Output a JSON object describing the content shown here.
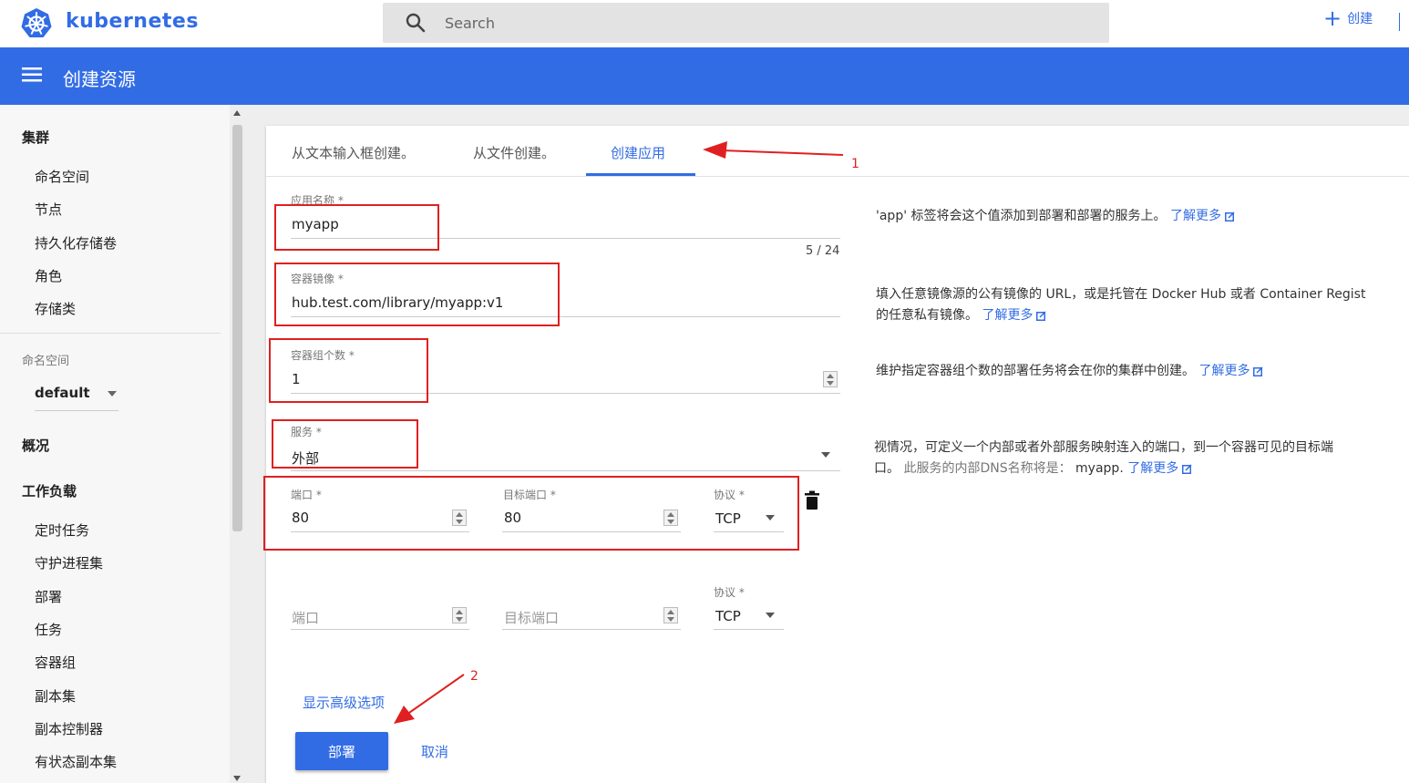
{
  "app": {
    "name": "kubernetes"
  },
  "search": {
    "placeholder": "Search"
  },
  "topbar": {
    "create_label": "创建",
    "create_icon": "plus-icon"
  },
  "header": {
    "title": "创建资源",
    "menu_icon": "hamburger-menu-icon"
  },
  "sidebar": {
    "cluster": {
      "title": "集群",
      "items": [
        "命名空间",
        "节点",
        "持久化存储卷",
        "角色",
        "存储类"
      ]
    },
    "namespace": {
      "label": "命名空间",
      "value": "default"
    },
    "overview": "概况",
    "workloads": {
      "title": "工作负载",
      "items": [
        "定时任务",
        "守护进程集",
        "部署",
        "任务",
        "容器组",
        "副本集",
        "副本控制器",
        "有状态副本集"
      ]
    }
  },
  "tabs": [
    {
      "label": "从文本输入框创建。",
      "active": false
    },
    {
      "label": "从文件创建。",
      "active": false
    },
    {
      "label": "创建应用",
      "active": true
    }
  ],
  "form": {
    "app_name": {
      "label": "应用名称 *",
      "value": "myapp",
      "counter": "5 / 24"
    },
    "image": {
      "label": "容器镜像 *",
      "value": "hub.test.com/library/myapp:v1"
    },
    "pods": {
      "label": "容器组个数 *",
      "value": "1"
    },
    "service": {
      "label": "服务 *",
      "value": "外部"
    },
    "port_row1": {
      "port_label": "端口 *",
      "port_value": "80",
      "target_label": "目标端口 *",
      "target_value": "80",
      "protocol_label": "协议 *",
      "protocol_value": "TCP"
    },
    "port_row2": {
      "port_placeholder": "端口",
      "target_placeholder": "目标端口",
      "protocol_label": "协议 *",
      "protocol_value": "TCP"
    }
  },
  "help": {
    "app_name": "'app' 标签将会这个值添加到部署和部署的服务上。",
    "image_line1": "填入任意镜像源的公有镜像的 URL，或是托管在 Docker Hub 或者 Container Regist",
    "image_line2": "的任意私有镜像。",
    "pods": "维护指定容器组个数的部署任务将会在你的集群中创建。",
    "service_line1": "视情况，可定义一个内部或者外部服务映射连入的端口，到一个容器可见的目标端",
    "service_line2_a": "口。",
    "service_line2_b": "此服务的内部DNS名称将是：",
    "service_dns": "myapp.",
    "learn_more": "了解更多"
  },
  "actions": {
    "advanced": "显示高级选项",
    "deploy": "部署",
    "cancel": "取消"
  },
  "annotations": {
    "one": "1",
    "two": "2"
  },
  "colors": {
    "accent": "#326ce5",
    "annotation": "#e02020"
  }
}
